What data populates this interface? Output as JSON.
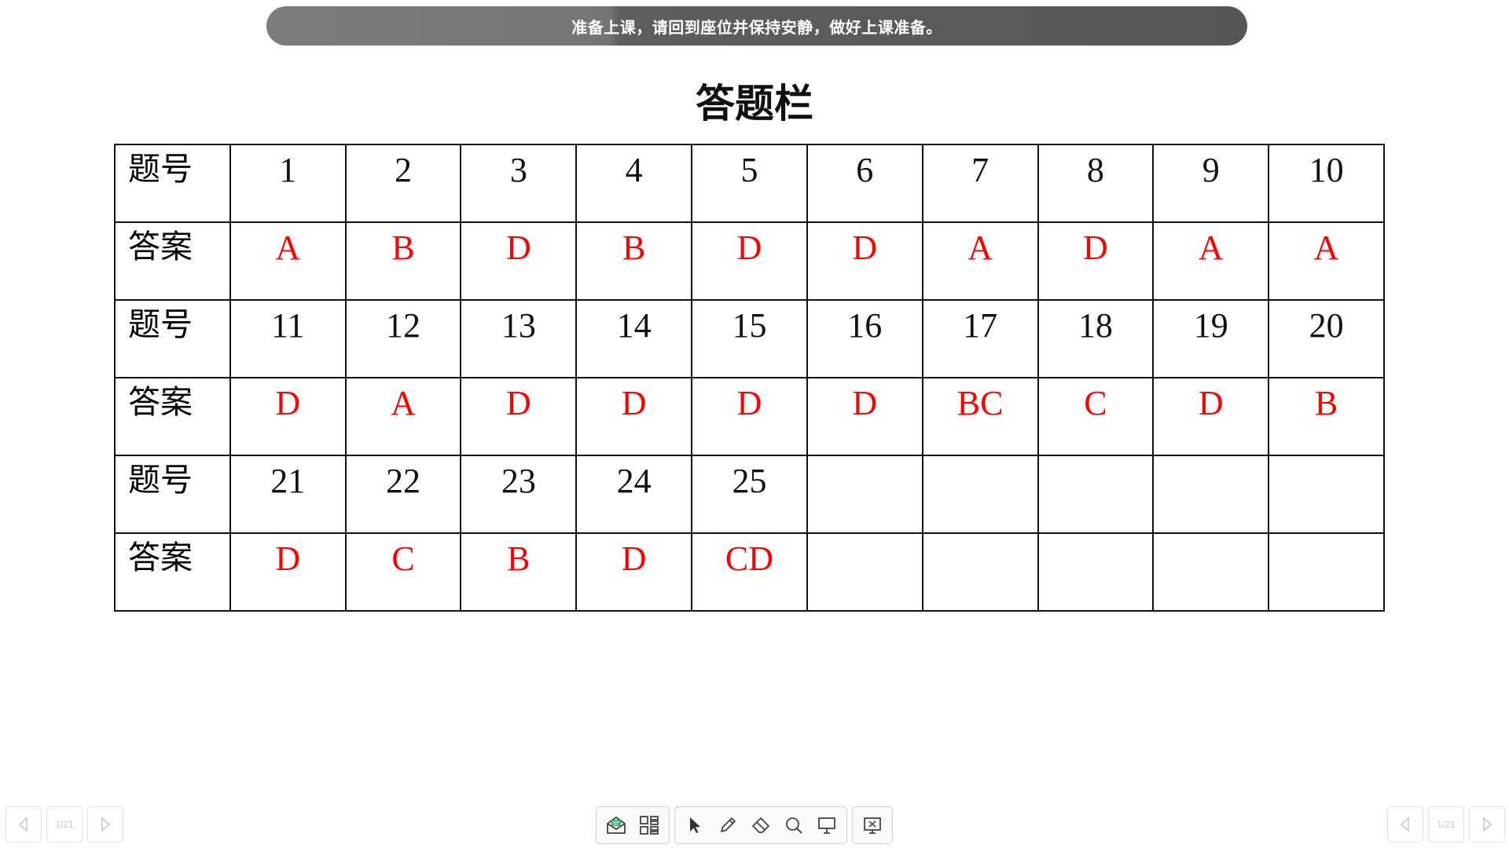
{
  "notice": "准备上课，请回到座位并保持安静，做好上课准备。",
  "title": "答题栏",
  "table": {
    "rows": [
      {
        "kind": "num",
        "label": "题号",
        "cells": [
          "1",
          "2",
          "3",
          "4",
          "5",
          "6",
          "7",
          "8",
          "9",
          "10"
        ]
      },
      {
        "kind": "ans",
        "label": "答案",
        "cells": [
          "A",
          "B",
          "D",
          "B",
          "D",
          "D",
          "A",
          "D",
          "A",
          "A"
        ]
      },
      {
        "kind": "num",
        "label": "题号",
        "cells": [
          "11",
          "12",
          "13",
          "14",
          "15",
          "16",
          "17",
          "18",
          "19",
          "20"
        ]
      },
      {
        "kind": "ans",
        "label": "答案",
        "cells": [
          "D",
          "A",
          "D",
          "D",
          "D",
          "D",
          "BC",
          "C",
          "D",
          "B"
        ]
      },
      {
        "kind": "num",
        "label": "题号",
        "cells": [
          "21",
          "22",
          "23",
          "24",
          "25",
          "",
          "",
          "",
          "",
          ""
        ]
      },
      {
        "kind": "ans",
        "label": "答案",
        "cells": [
          "D",
          "C",
          "B",
          "D",
          "CD",
          "",
          "",
          "",
          "",
          ""
        ]
      }
    ]
  },
  "colors": {
    "answer": "#ff0000",
    "number": "#111111"
  },
  "pager_left": {
    "page": "1/21",
    "prev_icon": "chevron-left-icon",
    "next_icon": "chevron-right-icon"
  },
  "pager_right": {
    "page": "1/21",
    "prev_icon": "chevron-left-icon",
    "next_icon": "chevron-right-icon"
  },
  "toolbar": {
    "group1": [
      {
        "icon": "envelope-icon"
      },
      {
        "icon": "apps-grid-icon"
      }
    ],
    "group2": [
      {
        "icon": "pointer-icon"
      },
      {
        "icon": "pen-icon"
      },
      {
        "icon": "eraser-icon"
      },
      {
        "icon": "magnifier-icon"
      },
      {
        "icon": "whiteboard-icon"
      }
    ],
    "group3": [
      {
        "icon": "exit-presentation-icon"
      }
    ]
  }
}
